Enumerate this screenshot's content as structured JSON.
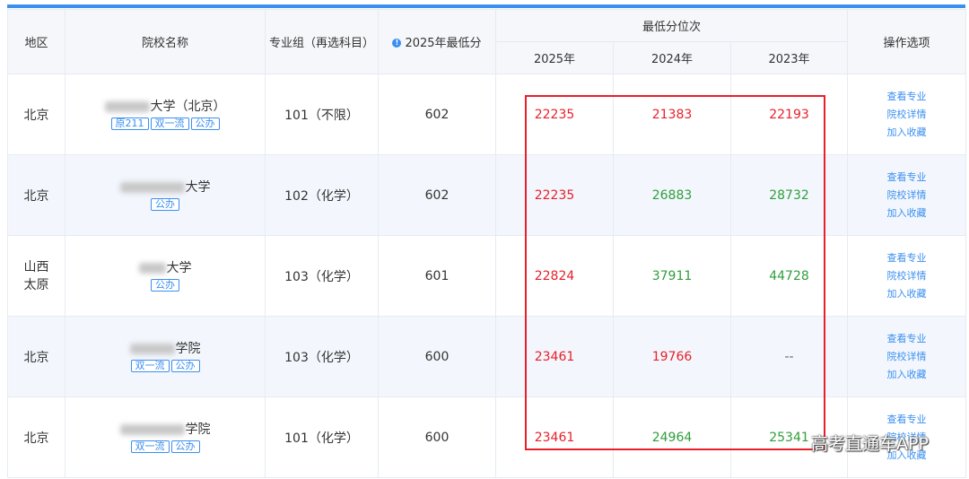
{
  "header": {
    "region": "地区",
    "school_name": "院校名称",
    "major_group": "专业组（再选科目）",
    "min_score": "2025年最低分",
    "min_rank_group": "最低分位次",
    "years": [
      "2025年",
      "2024年",
      "2023年"
    ],
    "actions": "操作选项"
  },
  "rows": [
    {
      "region": "北京",
      "school_visible": "大学（北京）",
      "tags": [
        "原211",
        "双一流",
        "公办"
      ],
      "group": "101（不限）",
      "score": "602",
      "ranks": [
        "22235",
        "21383",
        "22193"
      ],
      "rank_colors": [
        "red",
        "red",
        "red"
      ]
    },
    {
      "region": "北京",
      "school_visible": "大学",
      "tags": [
        "公办"
      ],
      "group": "102（化学）",
      "score": "602",
      "ranks": [
        "22235",
        "26883",
        "28732"
      ],
      "rank_colors": [
        "red",
        "green",
        "green"
      ]
    },
    {
      "region_line1": "山西",
      "region_line2": "太原",
      "school_visible": "大学",
      "tags": [
        "公办"
      ],
      "group": "103（化学）",
      "score": "601",
      "ranks": [
        "22824",
        "37911",
        "44728"
      ],
      "rank_colors": [
        "red",
        "green",
        "green"
      ]
    },
    {
      "region": "北京",
      "school_visible": "学院",
      "tags": [
        "双一流",
        "公办"
      ],
      "group": "103（化学）",
      "score": "600",
      "ranks": [
        "23461",
        "19766",
        "--"
      ],
      "rank_colors": [
        "red",
        "red",
        "dash"
      ]
    },
    {
      "region": "北京",
      "school_visible": "学院",
      "tags": [
        "双一流",
        "公办"
      ],
      "group": "101（化学）",
      "score": "600",
      "ranks": [
        "23461",
        "24964",
        "25341"
      ],
      "rank_colors": [
        "red",
        "green",
        "green"
      ]
    }
  ],
  "actions": {
    "view_major": "查看专业",
    "school_detail": "院校详情",
    "add_favorite": "加入收藏"
  },
  "watermark": "高考直通车APP",
  "colors": {
    "accent": "#3b8ff0",
    "rank_up": "#e8202a",
    "rank_down": "#2e9e3b",
    "alt_row": "#f3f7fd",
    "header_bg": "#f5f7fa"
  },
  "icons": {
    "score_header_icon": "info-icon"
  }
}
